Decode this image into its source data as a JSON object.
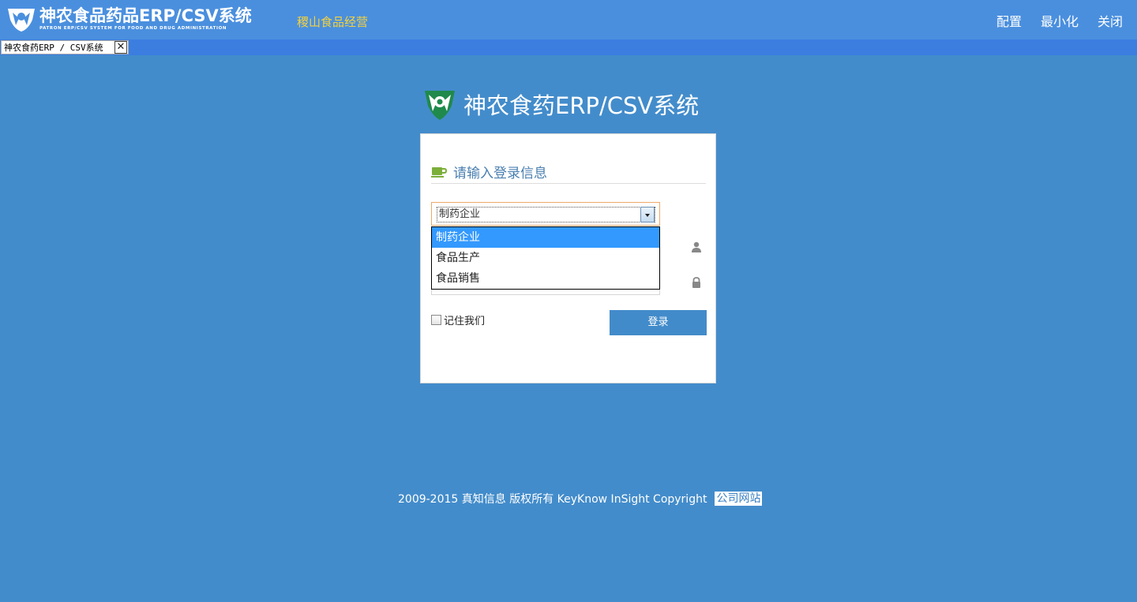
{
  "header": {
    "title": "神农食品药品ERP/CSV系统",
    "subtitle": "PATRON ERP/CSV SYSTEM FOR FOOD AND DRUG ADMINISTRATION",
    "company": "稷山食品经营",
    "actions": [
      "配置",
      "最小化",
      "关闭"
    ]
  },
  "tab": {
    "label": "神农食药ERP / CSV系统",
    "close": "✕"
  },
  "center": {
    "title": "神农食药ERP/CSV系统"
  },
  "login": {
    "heading": "请输入登录信息",
    "select_value": "制药企业",
    "options": [
      "制药企业",
      "食品生产",
      "食品销售"
    ],
    "selected_index": 0,
    "remember_label": "记住我们",
    "submit_label": "登录"
  },
  "footer": {
    "text": "2009-2015 真知信息 版权所有 KeyKnow InSight Copyright",
    "link": "公司网站"
  },
  "colors": {
    "background": "#438ccb",
    "topbar": "#4a8fde",
    "tabstrip": "#3b7ee0",
    "company": "#f4d23c",
    "button": "#428bca",
    "dropdown_active": "#3399ff",
    "logo_green": "#1f8a4c"
  }
}
